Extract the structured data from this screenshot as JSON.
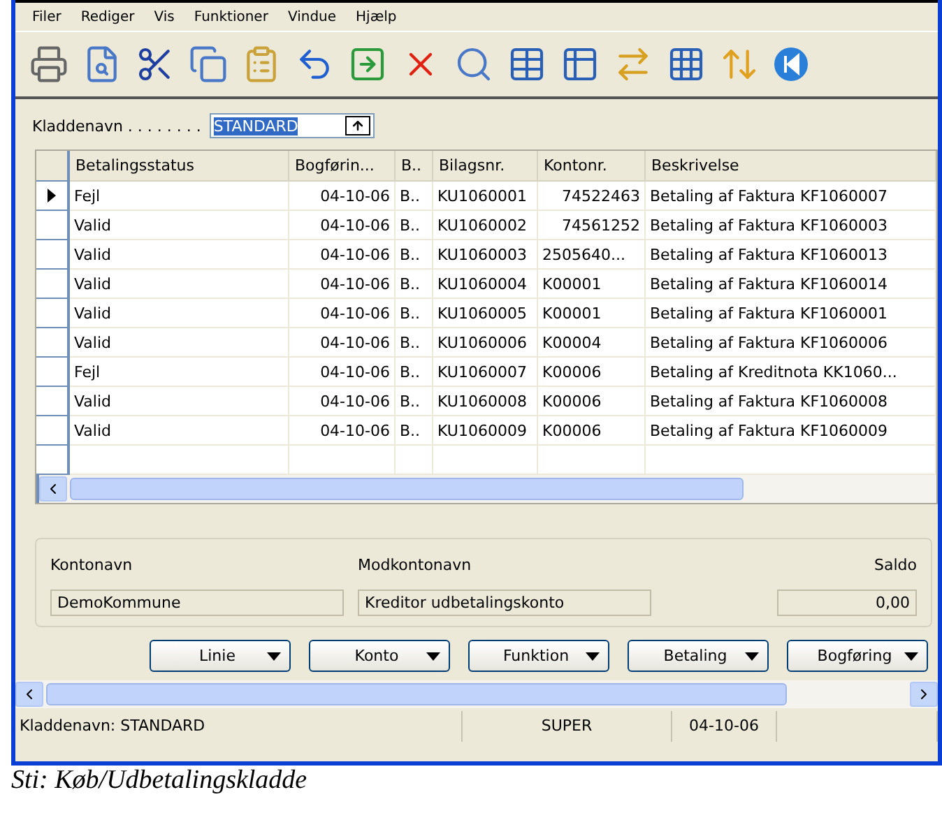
{
  "menu": [
    "Filer",
    "Rediger",
    "Vis",
    "Funktioner",
    "Vindue",
    "Hjælp"
  ],
  "journal_field": {
    "label": "Kladdenavn . . . . . . . .",
    "value": "STANDARD"
  },
  "table": {
    "columns": [
      "Betalingsstatus",
      "Bogførin...",
      "B..",
      "Bilagsnr.",
      "Kontonr.",
      "Beskrivelse"
    ],
    "rows": [
      {
        "selected": true,
        "cells": [
          "Fejl",
          "04-10-06",
          "B..",
          "KU1060001",
          "74522463",
          "Betaling af Faktura KF1060007"
        ]
      },
      {
        "selected": false,
        "cells": [
          "Valid",
          "04-10-06",
          "B..",
          "KU1060002",
          "74561252",
          "Betaling af Faktura KF1060003"
        ]
      },
      {
        "selected": false,
        "cells": [
          "Valid",
          "04-10-06",
          "B..",
          "KU1060003",
          "2505640...",
          "Betaling af Faktura KF1060013"
        ]
      },
      {
        "selected": false,
        "cells": [
          "Valid",
          "04-10-06",
          "B..",
          "KU1060004",
          "K00001",
          "Betaling af Faktura KF1060014"
        ]
      },
      {
        "selected": false,
        "cells": [
          "Valid",
          "04-10-06",
          "B..",
          "KU1060005",
          "K00001",
          "Betaling af Faktura KF1060001"
        ]
      },
      {
        "selected": false,
        "cells": [
          "Valid",
          "04-10-06",
          "B..",
          "KU1060006",
          "K00004",
          "Betaling af Faktura KF1060006"
        ]
      },
      {
        "selected": false,
        "cells": [
          "Fejl",
          "04-10-06",
          "B..",
          "KU1060007",
          "K00006",
          "Betaling af Kreditnota KK1060..."
        ]
      },
      {
        "selected": false,
        "cells": [
          "Valid",
          "04-10-06",
          "B..",
          "KU1060008",
          "K00006",
          "Betaling af Faktura KF1060008"
        ]
      },
      {
        "selected": false,
        "cells": [
          "Valid",
          "04-10-06",
          "B..",
          "KU1060009",
          "K00006",
          "Betaling af Faktura KF1060009"
        ]
      }
    ]
  },
  "info": [
    {
      "label": "Kontonavn",
      "value": "DemoKommune"
    },
    {
      "label": "Modkontonavn",
      "value": "Kreditor udbetalingskonto"
    },
    {
      "label": "Saldo",
      "value": "0,00"
    }
  ],
  "buttons": [
    "Linie",
    "Konto",
    "Funktion",
    "Betaling",
    "Bogføring"
  ],
  "status_bar": [
    "Kladdenavn: STANDARD",
    "SUPER",
    "04-10-06"
  ],
  "caption": "Sti: Køb/Udbetalingskladde"
}
